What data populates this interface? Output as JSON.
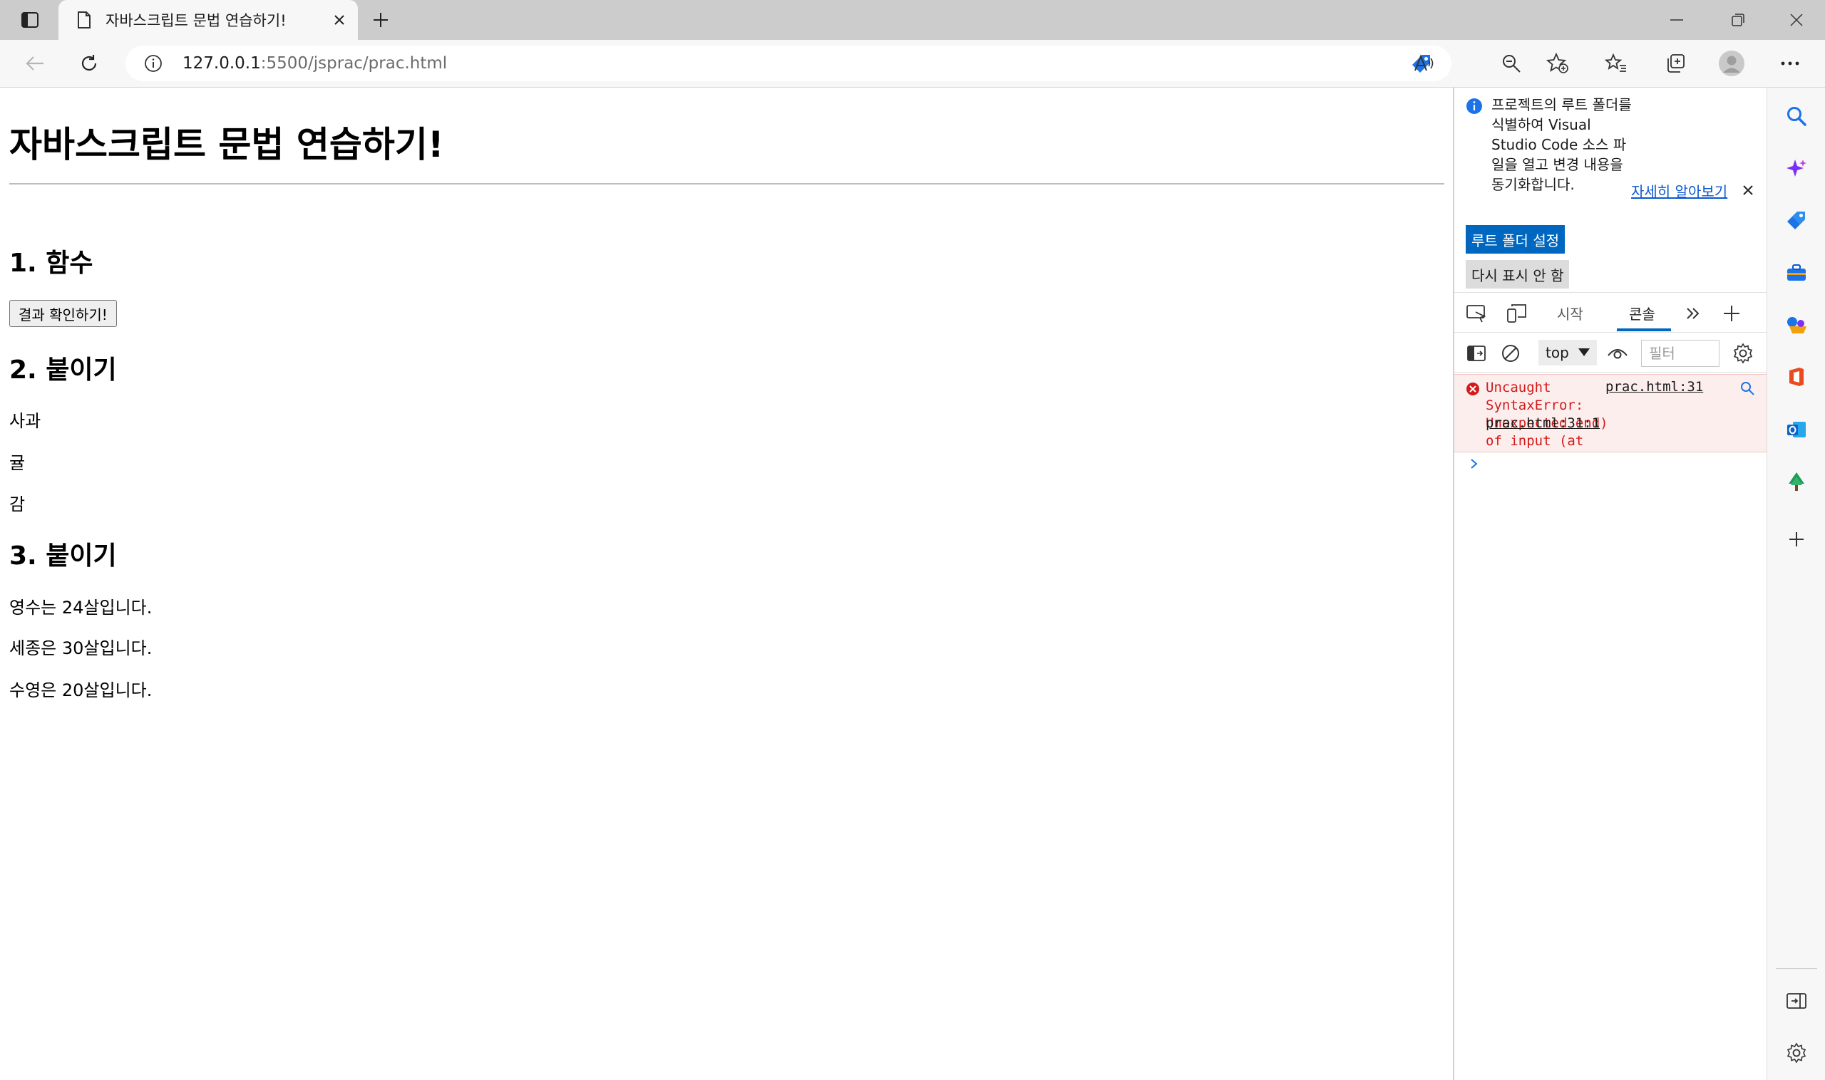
{
  "browser": {
    "tab": {
      "title": "자바스크립트 문법 연습하기!"
    },
    "address": {
      "host": "127.0.0.1",
      "rest": ":5500/jsprac/prac.html"
    }
  },
  "page": {
    "title": "자바스크립트 문법 연습하기!",
    "section1": {
      "heading": "1. 함수",
      "button_label": "결과 확인하기!"
    },
    "section2": {
      "heading": "2. 붙이기",
      "items": [
        "사과",
        "귤",
        "감"
      ]
    },
    "section3": {
      "heading": "3. 붙이기",
      "items": [
        "영수는 24살입니다.",
        "세종은 30살입니다.",
        "수영은 20살입니다."
      ]
    }
  },
  "devtools": {
    "banner": {
      "text": "프로젝트의 루트 폴더를 식별하여 Visual Studio Code 소스 파일을 열고 변경 내용을 동기화합니다.",
      "link": "자세히 알아보기",
      "primary_button": "루트 폴더 설정",
      "secondary_button": "다시 표시 안 함"
    },
    "tabs": {
      "welcome": "시작",
      "console": "콘솔"
    },
    "console": {
      "context": "top",
      "filter_placeholder": "필터",
      "error": {
        "message": "Uncaught\nSyntaxError:\nUnexpected end of input (at ",
        "source": "prac.html:31",
        "location": "prac.html:31:1",
        "location_suffix": ")"
      }
    }
  },
  "colors": {
    "accent": "#0067c0",
    "error_text": "#d21b1b",
    "error_bg": "#fdeeee"
  }
}
